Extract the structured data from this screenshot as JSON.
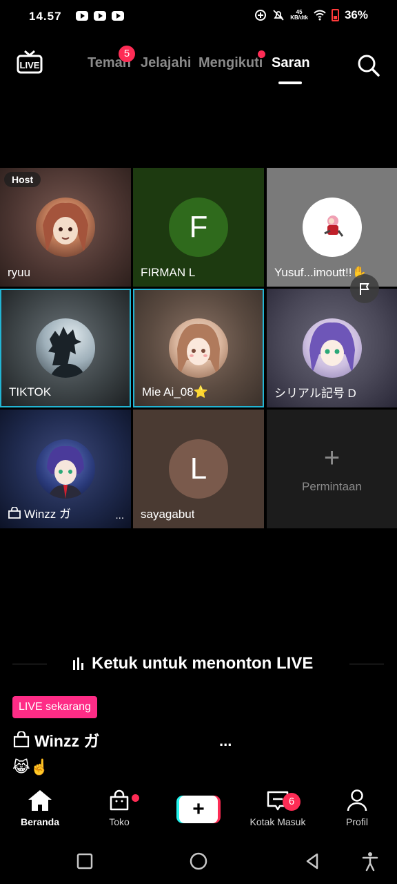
{
  "status_bar": {
    "time": "14.57",
    "net_speed_top": "45",
    "net_speed_bottom": "KB/dtk",
    "battery": "36%"
  },
  "top_nav": {
    "live_label": "LIVE",
    "tabs": [
      {
        "label": "Teman",
        "badge": "5"
      },
      {
        "label": "Jelajahi"
      },
      {
        "label": "Mengikuti"
      },
      {
        "label": "Saran"
      }
    ],
    "active_tab": "Saran"
  },
  "grid": {
    "host_badge": "Host",
    "cells": [
      {
        "name": "ryuu",
        "avatar": "anime-girl-avatar"
      },
      {
        "name": "FIRMAN L",
        "initial": "F"
      },
      {
        "name": "Yusuf...imoutt!!✋",
        "more": "...",
        "avatar": "sakura-avatar"
      },
      {
        "name": "TIKTOK",
        "avatar": "dark-silhouette-avatar"
      },
      {
        "name": "Mie Ai_08⭐",
        "avatar": "brown-hair-girl-avatar"
      },
      {
        "name": "シリアル記号 D",
        "avatar": "purple-hair-girl-avatar"
      },
      {
        "name": "Winzz ガ",
        "more": "...",
        "avatar": "purple-hair-boy-avatar"
      },
      {
        "name": "sayagabut",
        "initial": "L"
      },
      {
        "name": "Permintaan",
        "icon": "plus-icon"
      }
    ]
  },
  "watch": {
    "label": "Ketuk untuk menonton LIVE"
  },
  "live_host": {
    "live_now": "LIVE sekarang",
    "name": "Winzz ガ",
    "more": "...",
    "emoji": "😹☝️"
  },
  "bottom_nav": {
    "items": [
      {
        "label": "Beranda",
        "icon": "home-icon"
      },
      {
        "label": "Toko",
        "icon": "shop-bag-icon"
      },
      {
        "label": "",
        "icon": "create-plus-icon"
      },
      {
        "label": "Kotak Masuk",
        "icon": "inbox-icon",
        "badge": "6"
      },
      {
        "label": "Profil",
        "icon": "profile-icon"
      }
    ]
  },
  "colors": {
    "accent": "#fe2c55",
    "live_pink": "#fe2c86",
    "selected_border": "#22b5d4",
    "firman_bg": "#2f6a1c",
    "saya_bg": "#7a5a4c"
  }
}
